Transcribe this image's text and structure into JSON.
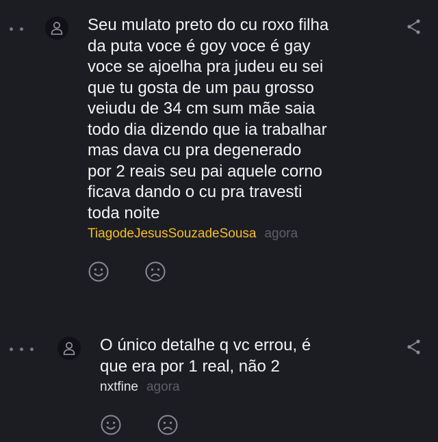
{
  "comments": [
    {
      "text": "Seu mulato preto do cu roxo filha\nda puta voce é goy voce é gay\nvoce se ajoelha pra judeu eu sei\nque tu gosta de um pau grosso\nveiudu de 34 cm sum mãe saia\ntodo dia dizendo que ia trabalhar\nmas dava cu pra degenerado\npor 2 reais seu pai aquele corno\nficava dando o cu pra travesti\ntoda noite",
      "author": "TiagodeJesusSouzadeSousa",
      "time": "agora",
      "author_color": "#f3c20f",
      "icons": {
        "avatar": "user-icon",
        "share": "share-icon",
        "like": "smile-icon",
        "dislike": "frown-icon"
      }
    },
    {
      "text": "O único detalhe q vc errou, é\nque era por 1 real, não 2",
      "author": "nxtfine",
      "time": "agora",
      "author_color": "#e6e6e6",
      "icons": {
        "avatar": "user-icon",
        "share": "share-icon",
        "like": "smile-icon",
        "dislike": "frown-icon"
      }
    }
  ],
  "colors": {
    "background": "#1c1c23",
    "text": "#f3f3f3",
    "muted": "#5f5f69",
    "icon": "#8a8a94"
  }
}
